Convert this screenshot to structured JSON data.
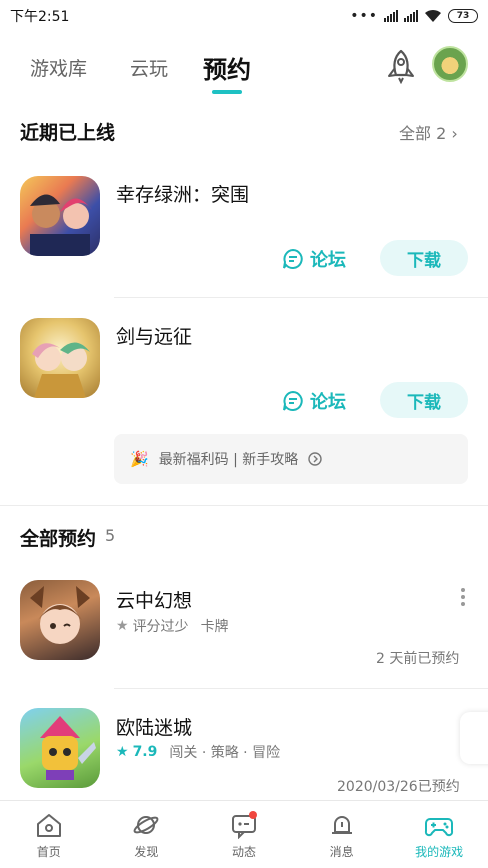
{
  "status": {
    "time": "下午2:51",
    "battery": "73"
  },
  "tabs": [
    "游戏库",
    "云玩",
    "预约"
  ],
  "recent": {
    "title": "近期已上线",
    "more": "全部 2",
    "games": [
      {
        "name": "幸存绿洲：突围",
        "forum": "论坛",
        "download": "下载"
      },
      {
        "name": "剑与远征",
        "forum": "论坛",
        "download": "下载"
      }
    ],
    "promo": "最新福利码 | 新手攻略"
  },
  "reserved": {
    "title": "全部预约",
    "count": "5",
    "games": [
      {
        "name": "云中幻想",
        "rating": "评分过少",
        "tags": "卡牌",
        "note": "2 天前已预约"
      },
      {
        "name": "欧陆迷城",
        "rating": "7.9",
        "tags": "闯关 · 策略 · 冒险",
        "note": "2020/03/26已预约"
      }
    ]
  },
  "nav": [
    "首页",
    "发现",
    "动态",
    "消息",
    "我的游戏"
  ],
  "colors": {
    "accent": "#1bb8ba",
    "badge": "#f0473f"
  }
}
